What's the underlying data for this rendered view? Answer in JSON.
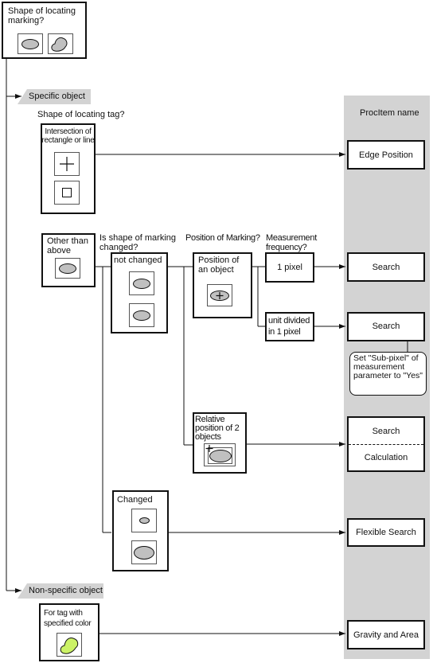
{
  "root": {
    "question": "Shape of locating marking?"
  },
  "branches": {
    "specific": "Specific object",
    "non_specific": "Non-specific object"
  },
  "questions": {
    "tag_shape": "Shape of locating tag?",
    "marking_changed": "Is shape of marking changed?",
    "marking_position": "Position of Marking?",
    "measurement_freq": "Measurement frequency?"
  },
  "nodes": {
    "intersection": "Intersection of rectangle or line",
    "other_than_above": "Other than above",
    "not_changed": "not changed",
    "position_object": "Position of an object",
    "one_pixel": "1 pixel",
    "unit_divided": "unit divided in 1 pixel",
    "relative_position": "Relative position of 2 objects",
    "changed": "Changed",
    "specified_color": "For tag with specified color"
  },
  "procitem": {
    "header": "ProcItem name",
    "items": {
      "edge_position": "Edge Position",
      "search_1": "Search",
      "search_2": "Search",
      "search_3": "Search",
      "calculation": "Calculation",
      "flexible_search": "Flexible Search",
      "gravity_area": "Gravity and Area"
    },
    "note": "Set \"Sub-pixel\" of measurement parameter to \"Yes\""
  },
  "colors": {
    "column_bg": "#d3d3d3",
    "shape_fill": "#c0c0c0",
    "color_tag_fill": "#ccf266"
  }
}
